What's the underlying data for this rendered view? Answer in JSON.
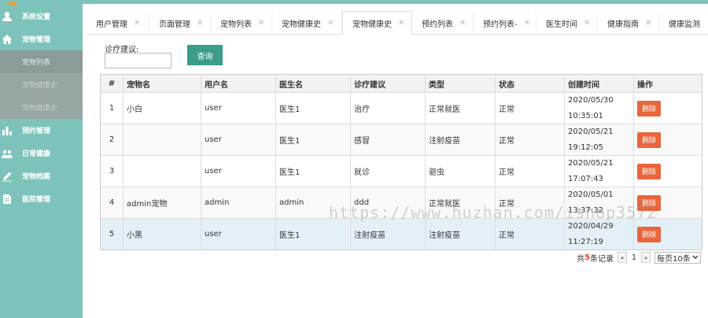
{
  "sidebar": {
    "items": [
      {
        "label": "系统设置",
        "icon": "user-icon"
      },
      {
        "label": "宠物管理",
        "icon": "home-icon"
      },
      {
        "label": "预约管理",
        "icon": "bar-chart-icon"
      },
      {
        "label": "日常健康",
        "icon": "users-icon"
      },
      {
        "label": "宠物档案",
        "icon": "edit-icon"
      },
      {
        "label": "医院管理",
        "icon": "document-icon"
      }
    ],
    "subitems": [
      {
        "label": "宠物列表"
      },
      {
        "label": "宠物健康史"
      },
      {
        "label": "宠物健康史"
      }
    ]
  },
  "tabs": [
    {
      "label": "用户管理"
    },
    {
      "label": "页面管理"
    },
    {
      "label": "宠物列表"
    },
    {
      "label": "宠物健康史"
    },
    {
      "label": "宠物健康史"
    },
    {
      "label": "预约列表"
    },
    {
      "label": "预约列表-"
    },
    {
      "label": "医生时间"
    },
    {
      "label": "健康指南"
    },
    {
      "label": "健康监测"
    }
  ],
  "search": {
    "label": "诊疗建议:",
    "value": "",
    "button": "查询"
  },
  "table": {
    "headers": [
      "#",
      "宠物名",
      "用户名",
      "医生名",
      "诊疗建议",
      "类型",
      "状态",
      "创建时间",
      "操作"
    ],
    "rows": [
      {
        "n": "1",
        "pet": "小白",
        "user": "user",
        "doctor": "医生1",
        "advice": "治疗",
        "type": "正常就医",
        "status": "正常",
        "date": "2020/05/30",
        "time": "10:35:01",
        "action": "删除"
      },
      {
        "n": "2",
        "pet": "",
        "user": "user",
        "doctor": "医生1",
        "advice": "感冒",
        "type": "注射疫苗",
        "status": "正常",
        "date": "2020/05/21",
        "time": "19:12:05",
        "action": "删除"
      },
      {
        "n": "3",
        "pet": "",
        "user": "user",
        "doctor": "医生1",
        "advice": "就诊",
        "type": "驱虫",
        "status": "正常",
        "date": "2020/05/21",
        "time": "17:07:43",
        "action": "删除"
      },
      {
        "n": "4",
        "pet": "admin宠物",
        "user": "admin",
        "doctor": "admin",
        "advice": "ddd",
        "type": "正常就医",
        "status": "正常",
        "date": "2020/05/01",
        "time": "13:37:32",
        "action": "删除"
      },
      {
        "n": "5",
        "pet": "小黑",
        "user": "user",
        "doctor": "医生1",
        "advice": "注射疫苗",
        "type": "注射疫苗",
        "status": "正常",
        "date": "2020/04/29",
        "time": "11:27:19",
        "action": "删除"
      }
    ]
  },
  "pagination": {
    "total_prefix": "共",
    "total": "5",
    "total_suffix": "条记录",
    "prev": "«",
    "current": "1",
    "next": "»",
    "per_page": "每页10条"
  },
  "watermark": "https://www.huzhan.com/ishop3572",
  "colors": {
    "sidebar": "#7dc3bb",
    "primary_button": "#3c9c8c",
    "delete_button": "#e8663c",
    "highlight_row": "#e4f0f8"
  }
}
